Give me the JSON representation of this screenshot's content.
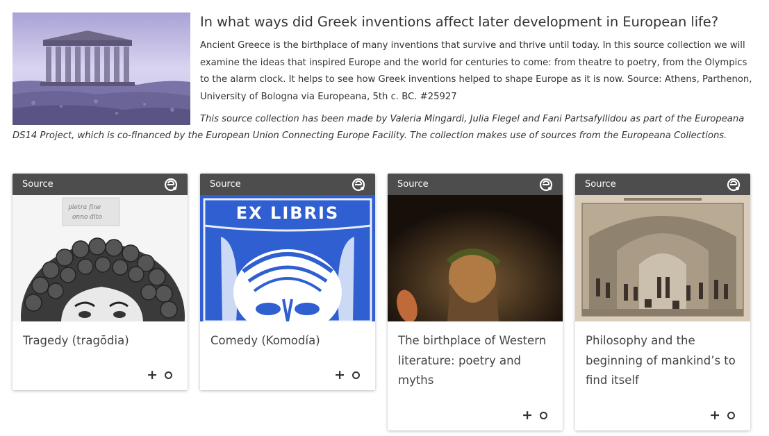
{
  "header": {
    "title": "In what ways did Greek inventions affect later development in European life?",
    "description": "Ancient Greece is the birthplace of many inventions that survive and thrive until today. In this source collection we will examine the ideas that inspired Europe and the world for centuries to come: from theatre to poetry, from the Olympics to the alarm clock. It helps to see how Greek inventions helped to shape Europe as it is now. Source: Athens, Parthenon, University of Bologna via Europeana, 5th c. BC. #25927",
    "credit": "This source collection has been made by Valeria Mingardi, Julia Flegel and Fani Partsafyllidou as part of the Europeana DS14 Project, which is co-financed by the European Union Connecting Europe Facility. The collection makes use of sources from the Europeana Collections."
  },
  "cards": [
    {
      "label": "Source",
      "title": "Tragedy (tragōdia)",
      "icon": "europeana-logo-icon"
    },
    {
      "label": "Source",
      "title": "Comedy (Komodía)",
      "icon": "europeana-logo-icon"
    },
    {
      "label": "Source",
      "title": "The birthplace of Western literature: poetry and myths",
      "icon": "europeana-logo-icon"
    },
    {
      "label": "Source",
      "title": "Philosophy and the beginning of mankind’s to find itself",
      "icon": "europeana-logo-icon"
    }
  ],
  "card_images": {
    "tragedy_note": "pietra fine, onno dito",
    "comedy_banner": "EX LIBRIS"
  },
  "actions": {
    "add_symbol": "+",
    "select_symbol": "○"
  },
  "colors": {
    "card_header": "#4d4d4d",
    "text": "#333333",
    "comedy_blue": "#2f5fd0"
  }
}
